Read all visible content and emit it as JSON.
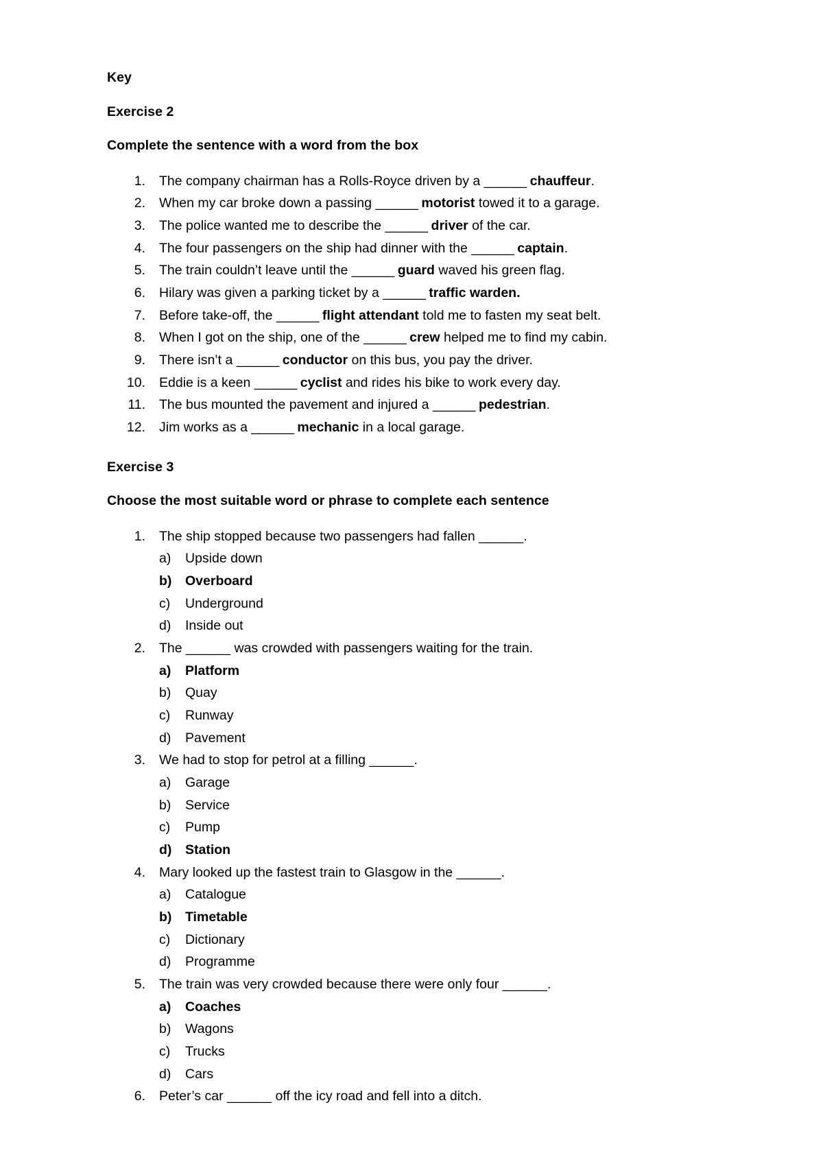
{
  "document": {
    "key_label": "Key",
    "exercise2": {
      "title": "Exercise 2",
      "instruction": "Complete the sentence with a word from the box",
      "items": [
        {
          "number": "1.",
          "before": "The company chairman has a Rolls-Royce driven by a ",
          "blank": "______ ",
          "answer": "chauffeur",
          "after": "."
        },
        {
          "number": "2.",
          "before": "When my car broke down a passing ",
          "blank": "______ ",
          "answer": "motorist",
          "after": " towed it to a garage."
        },
        {
          "number": "3.",
          "before": "The police wanted me to describe the ",
          "blank": "______ ",
          "answer": "driver",
          "after": " of the car."
        },
        {
          "number": "4.",
          "before": "The four passengers on the ship had dinner with the ",
          "blank": "______ ",
          "answer": "captain",
          "after": "."
        },
        {
          "number": "5.",
          "before": "The train couldn’t leave until the ",
          "blank": "______ ",
          "answer": "guard",
          "after": " waved his green flag."
        },
        {
          "number": "6.",
          "before": "Hilary was given a parking ticket by a ",
          "blank": "______ ",
          "answer": "traffic warden.",
          "after": ""
        },
        {
          "number": "7.",
          "before": "Before take-off, the ",
          "blank": "______ ",
          "answer": "flight attendant",
          "after": " told me to fasten my seat belt."
        },
        {
          "number": "8.",
          "before": "When I got on the ship, one of the ",
          "blank": "______ ",
          "answer": "crew",
          "after": " helped me to find my cabin."
        },
        {
          "number": "9.",
          "before": "There isn’t a ",
          "blank": "______ ",
          "answer": "conductor",
          "after": " on this bus, you pay the driver."
        },
        {
          "number": "10.",
          "before": "Eddie is a keen ",
          "blank": "______ ",
          "answer": "cyclist",
          "after": " and rides his bike to work every day."
        },
        {
          "number": "11.",
          "before": "The bus mounted the pavement and injured a ",
          "blank": "______ ",
          "answer": "pedestrian",
          "after": "."
        },
        {
          "number": "12.",
          "before": "Jim works as a ",
          "blank": "______ ",
          "answer": "mechanic",
          "after": " in a local garage."
        }
      ]
    },
    "exercise3": {
      "title": "Exercise 3",
      "instruction": "Choose the most suitable word or phrase to complete each sentence",
      "questions": [
        {
          "number": "1.",
          "text": "The ship stopped because two passengers had fallen ______.",
          "options": [
            {
              "marker": "a)",
              "label": "Upside down",
              "correct": false
            },
            {
              "marker": "b)",
              "label": "Overboard",
              "correct": true
            },
            {
              "marker": "c)",
              "label": "Underground",
              "correct": false
            },
            {
              "marker": "d)",
              "label": "Inside out",
              "correct": false
            }
          ]
        },
        {
          "number": "2.",
          "text": "The ______ was crowded with passengers waiting for the train.",
          "options": [
            {
              "marker": "a)",
              "label": "Platform",
              "correct": true
            },
            {
              "marker": "b)",
              "label": "Quay",
              "correct": false
            },
            {
              "marker": "c)",
              "label": "Runway",
              "correct": false
            },
            {
              "marker": "d)",
              "label": "Pavement",
              "correct": false
            }
          ]
        },
        {
          "number": "3.",
          "text": "We had to stop for petrol at a filling ______.",
          "options": [
            {
              "marker": "a)",
              "label": "Garage",
              "correct": false
            },
            {
              "marker": "b)",
              "label": "Service",
              "correct": false
            },
            {
              "marker": "c)",
              "label": "Pump",
              "correct": false
            },
            {
              "marker": "d)",
              "label": "Station",
              "correct": true
            }
          ]
        },
        {
          "number": "4.",
          "text": "Mary looked up the fastest train to Glasgow in the ______.",
          "options": [
            {
              "marker": "a)",
              "label": "Catalogue",
              "correct": false
            },
            {
              "marker": "b)",
              "label": "Timetable",
              "correct": true
            },
            {
              "marker": "c)",
              "label": "Dictionary",
              "correct": false
            },
            {
              "marker": "d)",
              "label": "Programme",
              "correct": false
            }
          ]
        },
        {
          "number": "5.",
          "text": "The train was very crowded because there were only four ______.",
          "options": [
            {
              "marker": "a)",
              "label": "Coaches",
              "correct": true
            },
            {
              "marker": "b)",
              "label": "Wagons",
              "correct": false
            },
            {
              "marker": "c)",
              "label": "Trucks",
              "correct": false
            },
            {
              "marker": "d)",
              "label": "Cars",
              "correct": false
            }
          ]
        },
        {
          "number": "6.",
          "text": "Peter’s car ______ off the icy road and fell into a ditch.",
          "options": []
        }
      ]
    }
  }
}
